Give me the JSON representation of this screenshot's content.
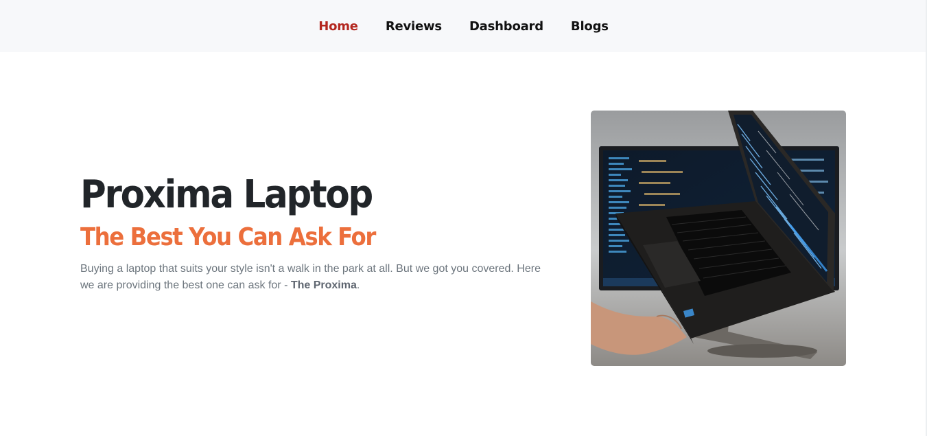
{
  "nav": {
    "items": [
      {
        "label": "Home",
        "active": true
      },
      {
        "label": "Reviews",
        "active": false
      },
      {
        "label": "Dashboard",
        "active": false
      },
      {
        "label": "Blogs",
        "active": false
      }
    ]
  },
  "hero": {
    "title": "Proxima Laptop",
    "subtitle": "The Best You Can Ask For",
    "description_text": "Buying a laptop that suits your style isn't a walk in the park at all. But we got you covered. Here we are providing the best one can ask for - ",
    "description_bold": "The Proxima",
    "description_end": "."
  },
  "colors": {
    "accent_active": "#b3261e",
    "subtitle_orange": "#ec6f3c",
    "title_dark": "#212529",
    "text_muted": "#6c757d",
    "nav_bg": "#f7f8fa"
  }
}
